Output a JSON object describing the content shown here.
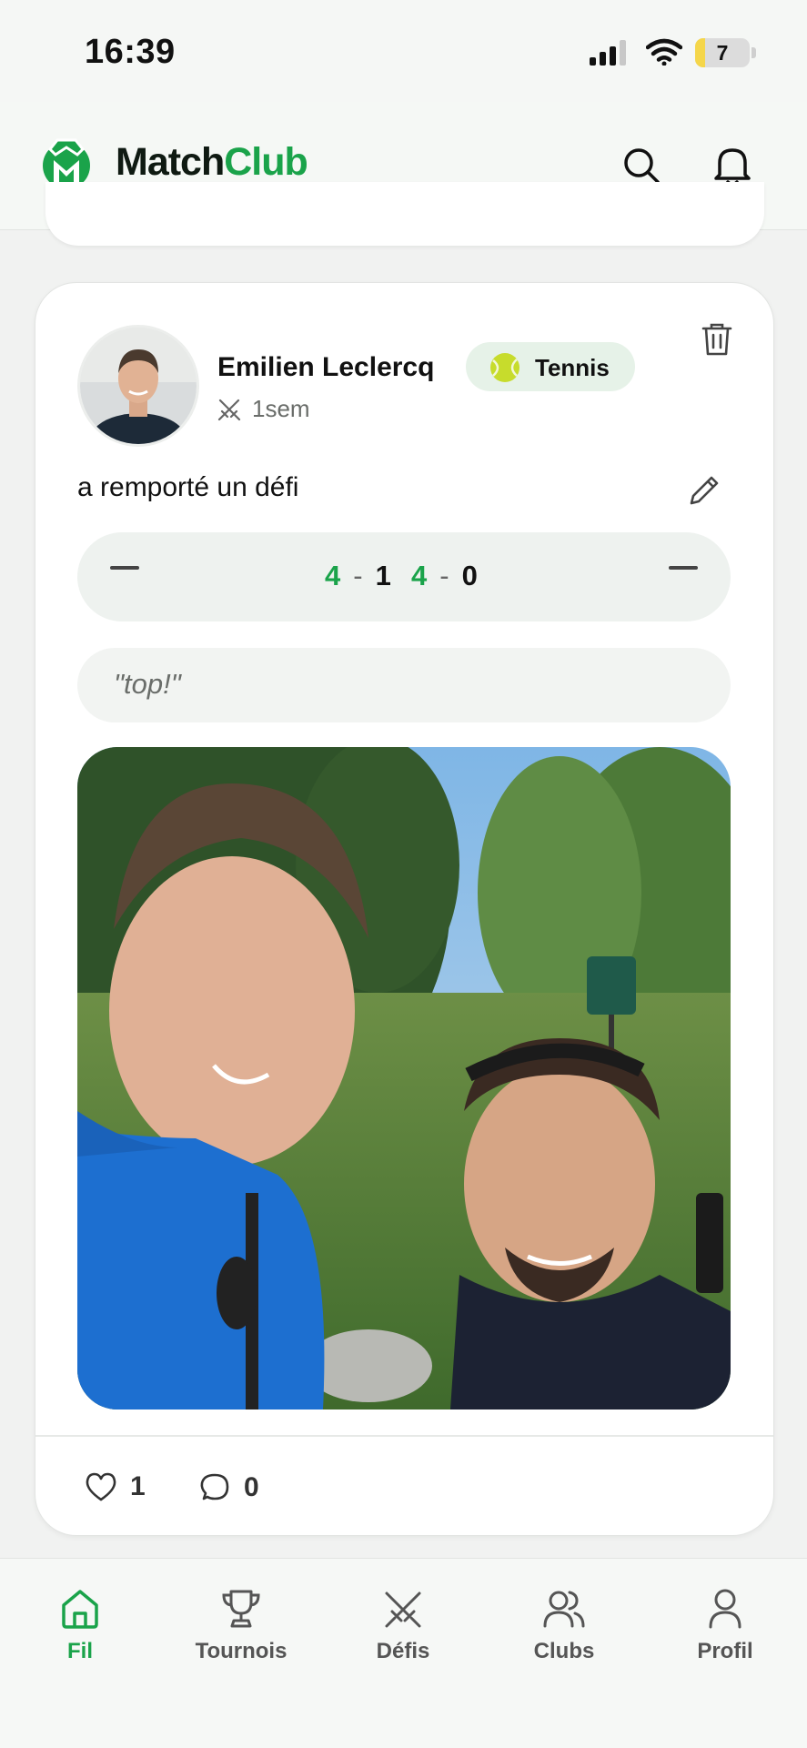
{
  "status_bar": {
    "time": "16:39",
    "battery": "7"
  },
  "header": {
    "logo_part1": "Match",
    "logo_part2": "Club",
    "search_icon": "search-icon",
    "bell_icon": "bell-icon"
  },
  "post": {
    "author": "Emilien Leclercq",
    "sport": "Tennis",
    "time_ago": "1sem",
    "action_text": "a remporté un défi",
    "score": {
      "left_placeholder": "—",
      "right_placeholder": "—",
      "sets": [
        {
          "a": "4",
          "sep": "-",
          "b": "1"
        },
        {
          "a": "4",
          "sep": "-",
          "b": "0"
        }
      ]
    },
    "comment": "\"top!\"",
    "likes": "1",
    "comments": "0"
  },
  "tabs": [
    {
      "label": "Fil",
      "icon": "home-icon",
      "active": true
    },
    {
      "label": "Tournois",
      "icon": "trophy-icon",
      "active": false
    },
    {
      "label": "Défis",
      "icon": "crossed-swords-icon",
      "active": false
    },
    {
      "label": "Clubs",
      "icon": "users-icon",
      "active": false
    },
    {
      "label": "Profil",
      "icon": "user-icon",
      "active": false
    }
  ],
  "colors": {
    "accent": "#1aa34a",
    "dark": "#0f1a12",
    "badge_bg": "#e6f2e8"
  }
}
